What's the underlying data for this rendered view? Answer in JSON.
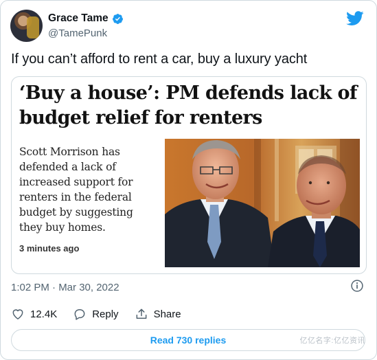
{
  "author": {
    "name": "Grace Tame",
    "handle": "@TamePunk",
    "verified": true,
    "avatar_icon": "user-avatar"
  },
  "tweet": {
    "text": "If you can’t afford to rent a car, buy a luxury yacht",
    "timestamp": "1:02 PM · Mar 30, 2022"
  },
  "article": {
    "headline": "‘Buy a house’: PM defends lack of budget relief for renters",
    "summary": "Scott Morrison has defended a lack of increased support for renters in the federal budget by suggesting they buy homes.",
    "age": "3 minutes ago"
  },
  "actions": {
    "likes_count": "12.4K",
    "reply_label": "Reply",
    "share_label": "Share"
  },
  "read_replies_label": "Read 730 replies",
  "watermark": "亿亿名字:亿亿资讯",
  "colors": {
    "accent": "#1d9bf0",
    "secondary_text": "#536471",
    "border": "#cfd9de"
  }
}
